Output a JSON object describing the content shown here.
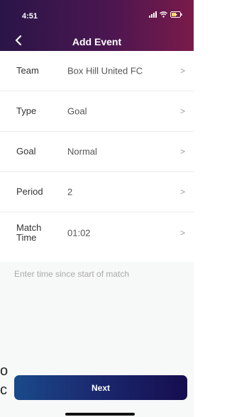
{
  "status": {
    "time": "4:51"
  },
  "header": {
    "title": "Add Event"
  },
  "rows": [
    {
      "label": "Team",
      "value": "Box Hill United FC",
      "chevron": ">"
    },
    {
      "label": "Type",
      "value": "Goal",
      "chevron": ">"
    },
    {
      "label": "Goal",
      "value": "Normal",
      "chevron": ">"
    },
    {
      "label": "Period",
      "value": "2",
      "chevron": ">"
    },
    {
      "label": "Match Time",
      "value": "01:02",
      "chevron": ">"
    }
  ],
  "help": {
    "text": "Enter time since start of match"
  },
  "edge_chars": [
    "o",
    "c"
  ],
  "next_button": {
    "label": "Next"
  }
}
